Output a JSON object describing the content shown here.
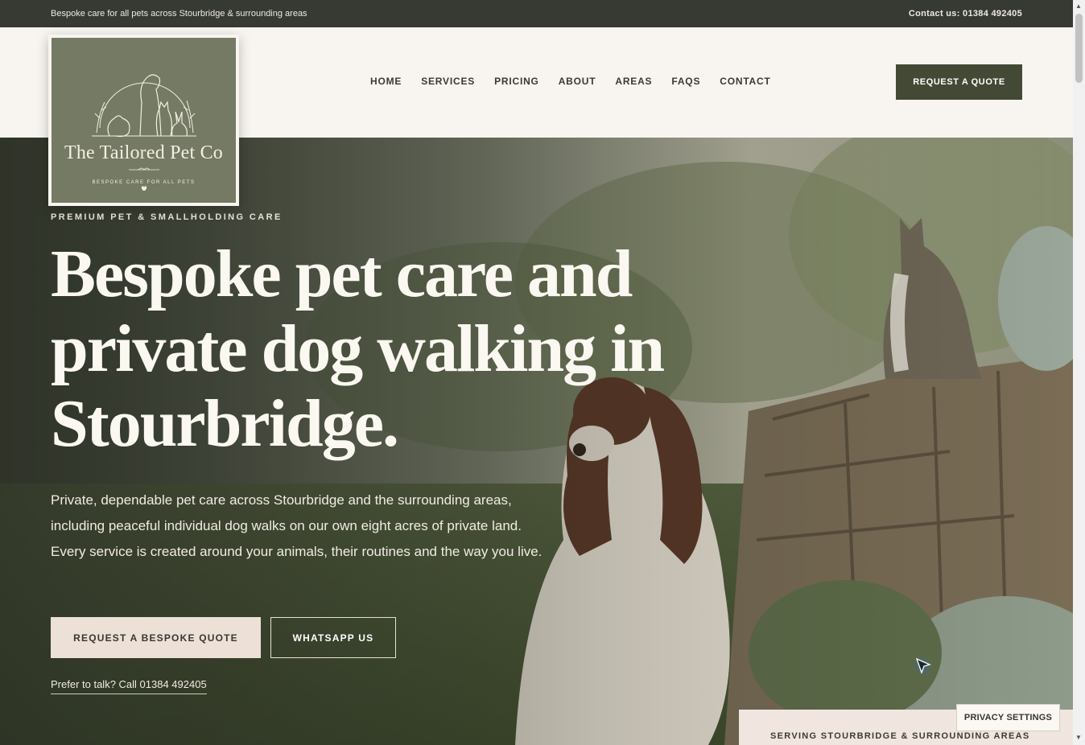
{
  "topbar": {
    "tagline": "Bespoke care for all pets across Stourbridge & surrounding areas",
    "contact": "Contact us: 01384 492405"
  },
  "logo": {
    "title": "The Tailored Pet Co",
    "subtitle": "BESPOKE CARE FOR ALL PETS"
  },
  "nav": {
    "items": [
      "HOME",
      "SERVICES",
      "PRICING",
      "ABOUT",
      "AREAS",
      "FAQS",
      "CONTACT"
    ],
    "quote_button": "REQUEST A QUOTE"
  },
  "hero": {
    "eyebrow": "PREMIUM PET & SMALLHOLDING CARE",
    "headline": "Bespoke pet care and private dog walking in Stourbridge.",
    "lede": "Private, dependable pet care across Stourbridge and the surrounding areas, including peaceful individual dog walks on our own eight acres of private land. Every service is created around your animals, their routines and the way you live.",
    "primary_button": "REQUEST A BESPOKE QUOTE",
    "secondary_button": "WHATSAPP US",
    "call_link": "Prefer to talk? Call 01384 492405"
  },
  "serving_banner": "SERVING STOURBRIDGE & SURROUNDING AREAS",
  "privacy_button": "PRIVACY SETTINGS",
  "colors": {
    "topbar": "#373a32",
    "accent": "#444936",
    "logo_bg": "#747a63",
    "button_light": "#ece0d7"
  }
}
